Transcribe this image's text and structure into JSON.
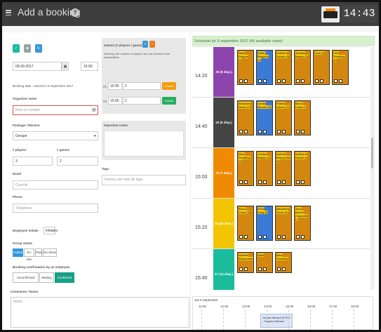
{
  "header": {
    "title": "Add a booking",
    "clock": "14:43"
  },
  "form": {
    "date": "09-09-2017",
    "time": "15:00",
    "booking_date": "Booking date : earned in 9 septembre 2017",
    "org_label": "Organizer name",
    "org_placeholder": "Nom ou compte",
    "package_label": "Package / Mission",
    "package_value": "Groupe",
    "players_label": "# players",
    "players_value": "3",
    "games_label": "# games",
    "games_value": "2",
    "email_label": "Email",
    "email_placeholder": "Courriel",
    "phone_label": "Phone",
    "phone_placeholder": "Téléphone",
    "employee_label": "Employee initials",
    "employee_value": "Initiales",
    "group_status_label": "Group status",
    "group_status": [
      "Invited",
      "On-site",
      "Paid",
      "No-show"
    ],
    "confirm_label": "Booking confirmation by an employee",
    "confirm_options": [
      "Unconfirmed",
      "Waiting",
      "Confirmed"
    ],
    "comments_label": "Comments / Notes",
    "comments_placeholder": "Notes",
    "games_box_title": "Games (# players / game)",
    "games_box_warning": "Warning, the number of players are not checked from availabilities",
    "game1_label": "#1:",
    "game1_time": "15:00",
    "game1_count": "2",
    "game1_status": "Il reste",
    "game2_label": "#2:",
    "game2_time": "15:00",
    "game2_count": "2",
    "game2_status": "Il reste",
    "important_label": "Important notes",
    "tags_label": "Tags",
    "tags_placeholder": "Insérez une liste de tags"
  },
  "schedule": {
    "header": "Schedule for 9 septembre 2017 (40 available vests)",
    "rows": [
      {
        "time": "14:20",
        "slot": "26 (5 disp.)",
        "color": "#8e44ad"
      },
      {
        "time": "14:40",
        "slot": "20 (5 disp.)",
        "color": "#444444"
      },
      {
        "time": "15:00",
        "slot": "25 (7 disp.)",
        "color": "#f08a00"
      },
      {
        "time": "15:20",
        "slot": "20 (28 disp.)",
        "color": "#f2c500"
      },
      {
        "time": "15:40",
        "slot": "27 (13 disp.)",
        "color": "#1abc9c"
      }
    ],
    "bookings": [
      [
        "Nadia Gagnon (5)",
        "Adrian Bergeron (4)",
        "mathia ck Savoie (3)",
        "Jordane Magny (3)",
        "Kuzo (3)",
        "Line Tremblay (4)"
      ],
      [
        "Alexandra Jones (7)",
        "Jordan Ménard (8)",
        "Patricia Girard (11)",
        "Bruno Costa (7)"
      ],
      [
        "Marc Tremblay (4)",
        "Jordane Magny (2)",
        "Isabelle Beauchemin (4)",
        "mathia ck Savoie (4)"
      ],
      [
        "Bruno Costa (3)",
        "Kevin Kang (3)",
        "Alexandra Jones (2)",
        "Jean Benoît Cayouette (7)"
      ],
      [
        "Isabelle Beauchemin",
        "Adèle",
        "Marc Tremblay"
      ]
    ],
    "timeline_date": "Sat 9 September",
    "timeline_hours": [
      "11:00",
      "12:00",
      "13:00",
      "14:00",
      "15:00",
      "16:00",
      "17:00",
      "18:00"
    ],
    "timeline_event": "Jordan Ménard (FTDS - Hugues Ménard"
  },
  "colors": {
    "accent": "#27ae60",
    "teal": "#16a085",
    "cyan": "#3498db",
    "booking": "#d4870f"
  }
}
